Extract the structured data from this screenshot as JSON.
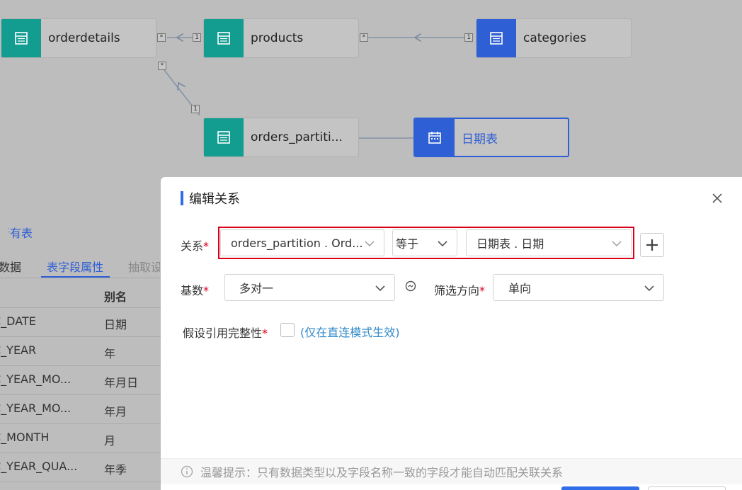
{
  "canvas": {
    "nodes": {
      "orderdetails": "orderdetails",
      "products": "products",
      "categories": "categories",
      "orders_partition": "orders_partiti...",
      "date_table": "日期表"
    },
    "badges": {
      "many": "*",
      "one": "1"
    }
  },
  "background_panel": {
    "all_tables_link": "所有表",
    "tabs": [
      "数据",
      "表字段属性",
      "抽取设"
    ],
    "alias_header": "别名",
    "rows": [
      {
        "field": "C_DATE",
        "alias": "日期"
      },
      {
        "field": "C_YEAR",
        "alias": "年"
      },
      {
        "field": "C_YEAR_MO...",
        "alias": "年月日"
      },
      {
        "field": "C_YEAR_MO...",
        "alias": "年月"
      },
      {
        "field": "C_MONTH",
        "alias": "月"
      },
      {
        "field": "C_YEAR_QUA...",
        "alias": "年季"
      }
    ]
  },
  "modal": {
    "title": "编辑关系",
    "relation_label": "关系",
    "relation_left": "orders_partition . Ord...",
    "relation_operator": "等于",
    "relation_right": "日期表 . 日期",
    "cardinality_label": "基数",
    "cardinality_value": "多对一",
    "filter_direction_label": "筛选方向",
    "filter_direction_value": "单向",
    "integrity_label": "假设引用完整性",
    "integrity_hint": "(仅在直连模式生效)",
    "required_mark": "*",
    "footer_tip": "温馨提示：只有数据类型以及字段名称一致的字段才能自动匹配关联关系"
  },
  "colors": {
    "accent": "#2f6ee8",
    "teal": "#139d91",
    "node_blue": "#2f5fd4",
    "required": "#d9001b"
  }
}
